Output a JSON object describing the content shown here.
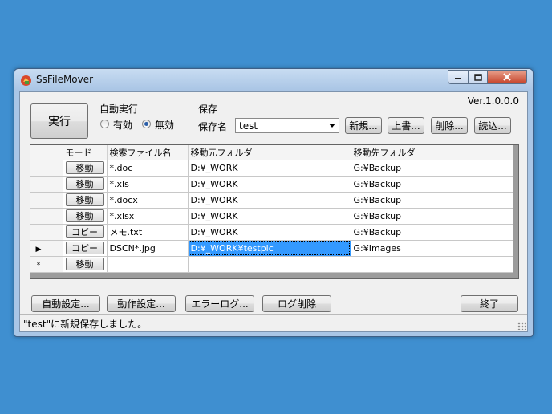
{
  "window": {
    "title": "SsFileMover"
  },
  "version": "Ver.1.0.0.0",
  "exec_button": "実行",
  "auto_exec": {
    "label": "自動実行",
    "option_on": "有効",
    "option_off": "無効",
    "selected": "off"
  },
  "save": {
    "label": "保存",
    "name_label": "保存名",
    "name_value": "test",
    "new_label": "新規...",
    "overwrite_label": "上書...",
    "delete_label": "削除...",
    "load_label": "読込..."
  },
  "grid": {
    "columns": [
      "モード",
      "検索ファイル名",
      "移動元フォルダ",
      "移動先フォルダ"
    ],
    "rows": [
      {
        "mode": "移動",
        "pattern": "*.doc",
        "src": "D:¥_WORK",
        "dst": "G:¥Backup"
      },
      {
        "mode": "移動",
        "pattern": "*.xls",
        "src": "D:¥_WORK",
        "dst": "G:¥Backup"
      },
      {
        "mode": "移動",
        "pattern": "*.docx",
        "src": "D:¥_WORK",
        "dst": "G:¥Backup"
      },
      {
        "mode": "移動",
        "pattern": "*.xlsx",
        "src": "D:¥_WORK",
        "dst": "G:¥Backup"
      },
      {
        "mode": "コピー",
        "pattern": "メモ.txt",
        "src": "D:¥_WORK",
        "dst": "G:¥Backup"
      },
      {
        "mode": "コピー",
        "pattern": "DSCN*.jpg",
        "src": "D:¥_WORK¥testpic",
        "dst": "G:¥Images"
      }
    ],
    "new_row": {
      "mode": "移動"
    },
    "current_row_marker": "▶",
    "new_row_marker": "*"
  },
  "bottom_buttons": {
    "auto_settings": "自動設定...",
    "action_settings": "動作設定...",
    "error_log": "エラーログ...",
    "log_delete": "ログ削除",
    "exit": "終了"
  },
  "status": {
    "message": "\"test\"に新規保存しました。"
  }
}
